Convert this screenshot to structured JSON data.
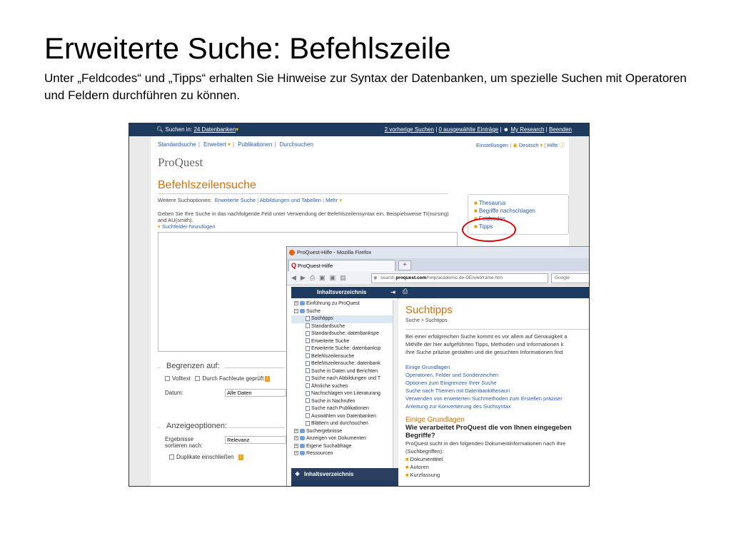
{
  "slide": {
    "title": "Erweiterte Suche: Befehlszeile",
    "subtitle": "Unter  „Feldcodes“ und „Tipps“ erhalten Sie Hinweise zur Syntax der Datenbanken, um spezielle Suchen mit Operatoren und Feldern durchführen zu können."
  },
  "topbar": {
    "search_in": "Suchen in:",
    "databases": "24 Datenbanken",
    "prev_searches": "2 vorherige Suchen",
    "selected": "0 ausgewählte Einträge",
    "my_research": "My Research",
    "quit": "Beenden"
  },
  "nav": {
    "standard": "Standardsuche",
    "advanced": "Erweitert",
    "publications": "Publikationen",
    "browse": "Durchsuchen",
    "settings": "Einstellungen",
    "language": "Deutsch",
    "help": "Hilfe"
  },
  "logo": "ProQuest",
  "page_title": "Befehlszeilensuche",
  "more_options": {
    "label": "Weitere Suchoptionen:",
    "items": [
      "Erweiterte Suche",
      "Abbildungen und Tabellen",
      "Mehr"
    ]
  },
  "hint_text": "Geben Sie Ihre Suche in das nachfolgende Feld unter Verwendung der Befehlszeilensyntax ein. Beispielsweise TI(nursing) and AU(smith).",
  "add_fields": "Suchfelder hinzufügen",
  "links_box": [
    "Thesaurus",
    "Begriffe nachschlagen",
    "Feldcodes",
    "Tipps"
  ],
  "limit": {
    "title": "Begrenzen auf:",
    "fulltext": "Volltext",
    "peer_reviewed": "Durch Fachleute geprüft",
    "date_label": "Datum:",
    "date_value": "Alle Daten"
  },
  "display": {
    "title": "Anzeigeoptionen:",
    "sort_label_1": "Ergebnisse",
    "sort_label_2": "sortieren nach:",
    "sort_value": "Relevanz",
    "duplicates": "Duplikate einschließen"
  },
  "popup": {
    "window_title": "ProQuest-Hilfe - Mozilla Firefox",
    "tab_label": "ProQuest-Hilfe",
    "url_prefix": "search.",
    "url_host": "proquest.com",
    "url_path": "/help/academic.de-DE/webframe.htm",
    "search_engine": "Google",
    "toc_title": "Inhaltsverzeichnis",
    "toc_items": [
      {
        "level": 0,
        "kind": "book",
        "label": "Einführung zu ProQuest"
      },
      {
        "level": 0,
        "kind": "book-open",
        "label": "Suche"
      },
      {
        "level": 1,
        "kind": "page",
        "label": "Suchtipps",
        "selected": true
      },
      {
        "level": 1,
        "kind": "page",
        "label": "Standardsuche"
      },
      {
        "level": 1,
        "kind": "page",
        "label": "Standardsuche: datenbankspe"
      },
      {
        "level": 1,
        "kind": "page",
        "label": "Erweiterte Suche"
      },
      {
        "level": 1,
        "kind": "page",
        "label": "Erweiterte Suche: datenbanksp"
      },
      {
        "level": 1,
        "kind": "page",
        "label": "Befehlszeilensuche"
      },
      {
        "level": 1,
        "kind": "page",
        "label": "Befehlszeilensuche: datenbank"
      },
      {
        "level": 1,
        "kind": "page",
        "label": "Suche in Daten und Berichten"
      },
      {
        "level": 1,
        "kind": "page",
        "label": "Suche nach Abbildungen und T"
      },
      {
        "level": 1,
        "kind": "page",
        "label": "Ähnliche suchen"
      },
      {
        "level": 1,
        "kind": "page",
        "label": "Nachschlagen von Literaturang"
      },
      {
        "level": 1,
        "kind": "page",
        "label": "Suche in Nachrufen"
      },
      {
        "level": 1,
        "kind": "page",
        "label": "Suche nach Publikationen"
      },
      {
        "level": 1,
        "kind": "page",
        "label": "Auswählen von Datenbanken"
      },
      {
        "level": 1,
        "kind": "page",
        "label": "Blättern und durchsuchen"
      },
      {
        "level": 0,
        "kind": "book",
        "label": "Suchergebnisse"
      },
      {
        "level": 0,
        "kind": "book",
        "label": "Anzeigen von Dokumenten"
      },
      {
        "level": 0,
        "kind": "book",
        "label": "Eigene Suchabfrage"
      },
      {
        "level": 0,
        "kind": "book",
        "label": "Ressourcen"
      }
    ],
    "toc_bottom": "Inhaltsverzeichnis",
    "content": {
      "title": "Suchtipps",
      "breadcrumb": "Suche > Suchtipps",
      "intro_1": "Bei einer erfolgreichen Suche kommt es vor allem auf Genauigkeit a",
      "intro_2": "Mithilfe der hier aufgeführten Tipps, Methoden und Informationen k",
      "intro_3": "Ihre Suche präzise gestalten und die gesuchten Informationen find",
      "links": [
        "Einige Grundlagen",
        "Operatoren, Felder und Sonderzeichen",
        "Optionen zum Eingrenzen Ihrer Suche",
        "Suche nach Themen mit Datenbankthesauri",
        "Verwenden von erweiterten Suchmethoden zum Erstellen präziser",
        "Anleitung zur Konvertierung des Suchsyntax"
      ],
      "section": "Einige Grundlagen",
      "question_1": "Wie verarbeitet ProQuest die von Ihnen eingegeben",
      "question_2": "Begriffe?",
      "para_1": "ProQuest sucht in den folgenden Dokumentinformationen nach Ihre",
      "para_2": "(Suchbegriffen):",
      "bullets": [
        "Dokumenttitel",
        "Autoren",
        "Kurzfassung"
      ]
    }
  }
}
